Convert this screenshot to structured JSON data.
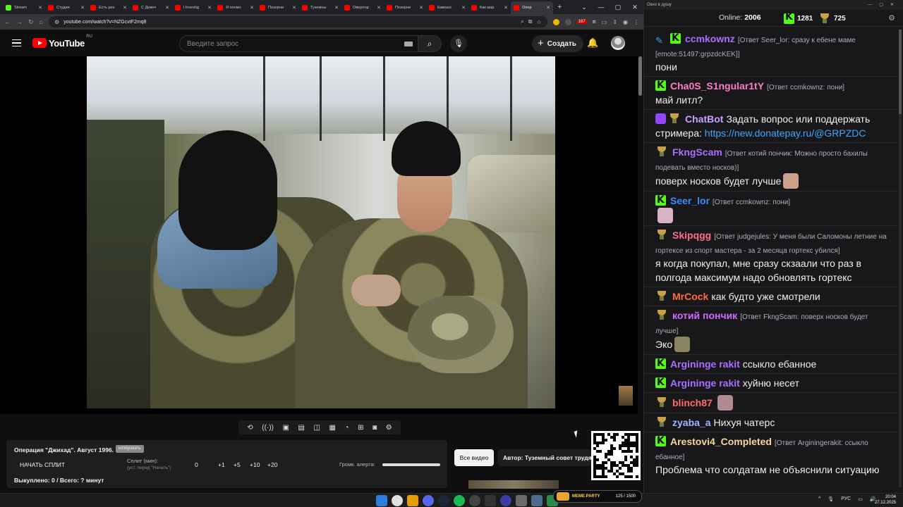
{
  "browser": {
    "tabs": [
      {
        "label": "Stream",
        "color": "#53fc18"
      },
      {
        "label": "Студия",
        "color": "#ff0000"
      },
      {
        "label": "Есть pes",
        "color": "#ff0000"
      },
      {
        "label": "С Девоч",
        "color": "#ff0000"
      },
      {
        "label": "l Investig",
        "color": "#ff0000"
      },
      {
        "label": "Я посмо",
        "color": "#ff0000"
      },
      {
        "label": "Позорни",
        "color": "#ff0000"
      },
      {
        "label": "Туземны",
        "color": "#ff0000"
      },
      {
        "label": "Оверлор",
        "color": "#ff0000"
      },
      {
        "label": "Позорни",
        "color": "#ff0000"
      },
      {
        "label": "Кавказс",
        "color": "#ff0000"
      },
      {
        "label": "Как мар",
        "color": "#ff0000"
      },
      {
        "label": "Опер",
        "color": "#ff0000",
        "active": true
      }
    ],
    "url": "youtube.com/watch?v=NZGcvtF2mq8",
    "ext_badge": "187"
  },
  "youtube": {
    "logo_text": "YouTube",
    "logo_region": "RU",
    "search_placeholder": "Введите запрос",
    "create_label": "Создать"
  },
  "panel": {
    "video_title": "Операция \"Джихад\". Август 1996.",
    "copy_label": "копировать",
    "start_split": "НАЧАТЬ СПЛИТ",
    "split_label": "Сплит (мин):",
    "split_hint": "(уст. перед \"Начать\")",
    "split_values": [
      "0",
      "+1",
      "+5",
      "+10",
      "+20"
    ],
    "alert_volume_label": "Громк. алерта:",
    "bought": "Выкуплено: 0 / Всего: ? минут",
    "all_videos": "Все видео",
    "author": "Автор: Туземный совет трудя"
  },
  "chat": {
    "window_title": "Окно в душу",
    "online_label": "Online:",
    "online_count": "2006",
    "points_k": "1281",
    "points_t": "725",
    "messages": [
      {
        "badges": [
          "S",
          "K"
        ],
        "nick": "ccmkownz",
        "nick_color": "#a970ff",
        "reply": "[Ответ Seer_lor: сразу к ебене маме [emote:51497:grpzdcKEK]]",
        "text": "пони"
      },
      {
        "badges": [
          "K"
        ],
        "nick": "Cha0S_S1ngular1tY",
        "nick_color": "#ff7cc7",
        "reply": "[Ответ ccmkownz: пони]",
        "text": "май литл?"
      },
      {
        "badges": [
          "Bot",
          "T"
        ],
        "nick": "ChatBot",
        "nick_color": "#c7a3ff",
        "reply": "",
        "text": "Задать вопрос или поддержать стримера:",
        "link": "https://new.donatepay.ru/@GRPZDC"
      },
      {
        "badges": [
          "T"
        ],
        "nick": "FkngScam",
        "nick_color": "#a970ff",
        "reply": "[Ответ котий пончик: Можно просто бахилы подевать вместо носков)]",
        "text": "поверх носков будет лучше",
        "emote": "#c9a08a"
      },
      {
        "badges": [
          "K"
        ],
        "nick": "Seer_lor",
        "nick_color": "#3a8bff",
        "reply": "[Ответ ccmkownz: пони]",
        "text": "",
        "emote": "#d6b3c3"
      },
      {
        "badges": [
          "T"
        ],
        "nick": "Skipqgg",
        "nick_color": "#ff6b8a",
        "reply": "[Ответ judgejules: У меня были Саломоны летние на гортексе из спорт мастера - за 2 месяца гортекс убился]",
        "text": "я когда покупал, мне сразу скзаали что раз в полгода максимум надо обновлять гортекс"
      },
      {
        "badges": [
          "T"
        ],
        "nick": "MrCock",
        "nick_color": "#ff6b3a",
        "reply": "",
        "text": "как будто уже смотрели"
      },
      {
        "badges": [
          "T"
        ],
        "nick": "котий пончик",
        "nick_color": "#d16bff",
        "reply": "[Ответ FkngScam: поверх носков будет лучше]",
        "text": "Эко",
        "emote": "#8a8460"
      },
      {
        "badges": [
          "K"
        ],
        "nick": "Argininge rakit",
        "nick_color": "#a970ff",
        "reply": "",
        "text": "ссыкло ебанное"
      },
      {
        "badges": [
          "K"
        ],
        "nick": "Argininge rakit",
        "nick_color": "#a970ff",
        "reply": "",
        "text": "хуйню несет"
      },
      {
        "badges": [
          "T"
        ],
        "nick": "blinch87",
        "nick_color": "#ff6b6b",
        "reply": "",
        "text": "",
        "emote": "#b08a90"
      },
      {
        "badges": [
          "T"
        ],
        "nick": "zyaba_a",
        "nick_color": "#a3b4ff",
        "reply": "",
        "text": "Нихуя чатерс"
      },
      {
        "badges": [
          "K"
        ],
        "nick": "Arestovi4_Completed",
        "nick_color": "#f5d89a",
        "reply": "[Ответ Arginingerakit: ссыкло ебанное]",
        "text": "Проблема что солдатам не объяснили ситуацию"
      }
    ]
  },
  "taskbar": {
    "memeparty": "MEME PARTY",
    "memeparty_progress": "125 / 1500",
    "lang": "РУС",
    "time": "20:04",
    "date": "27.12.2025"
  }
}
